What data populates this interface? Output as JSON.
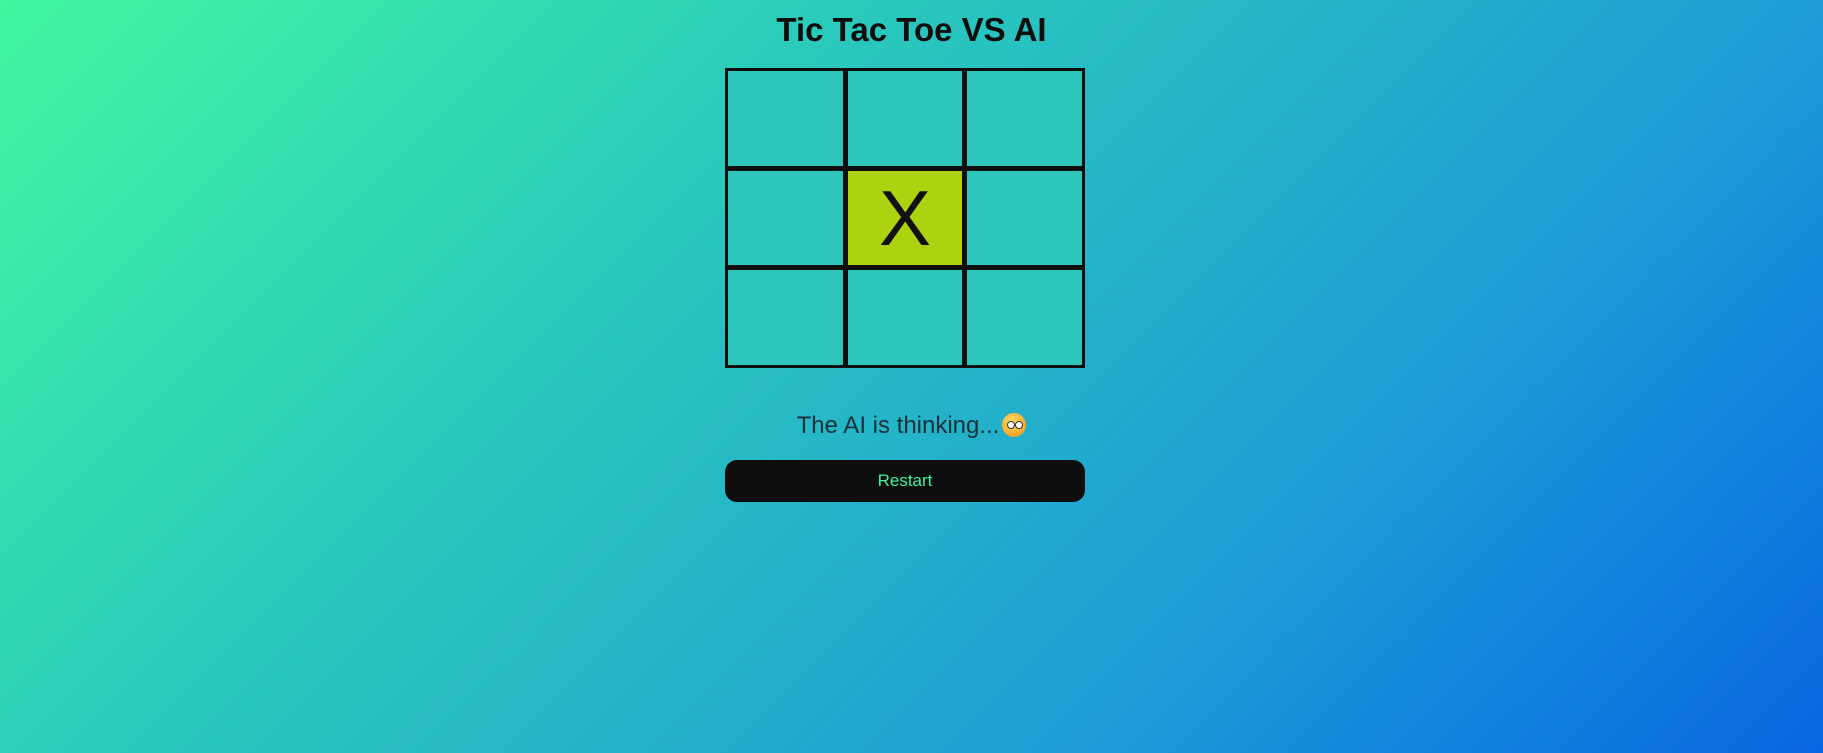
{
  "title": "Tic Tac Toe VS AI",
  "board": {
    "cells": [
      "",
      "",
      "",
      "",
      "X",
      "",
      "",
      "",
      ""
    ],
    "highlighted_cell": 4
  },
  "status": {
    "text": "The AI is thinking...",
    "emoji_icon": "thinking-face-icon"
  },
  "restart_label": "Restart",
  "colors": {
    "cell": "#2dc6bb",
    "highlight": "#acd30f",
    "grid_lines": "#0e0e0e",
    "button_bg": "#0e0e0e",
    "button_text": "#3ff5a0"
  }
}
